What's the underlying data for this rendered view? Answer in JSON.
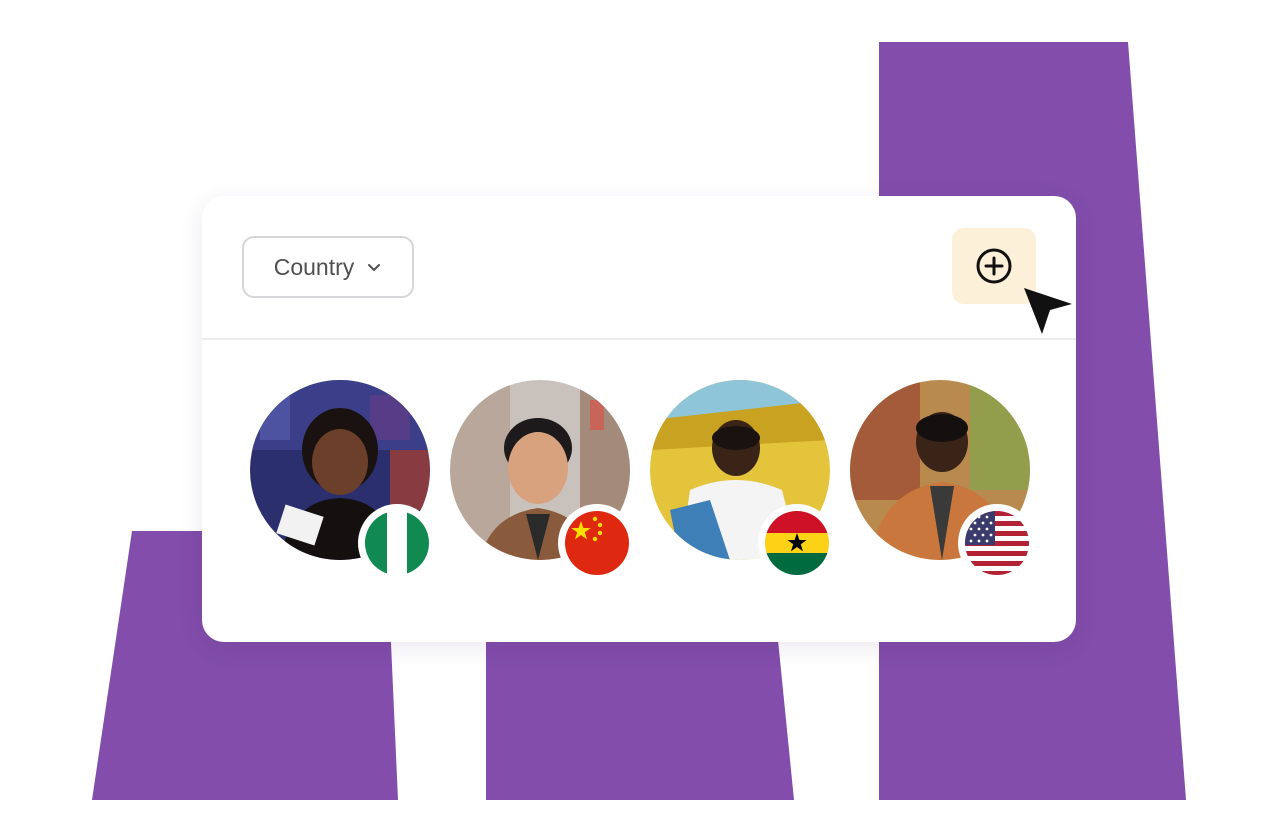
{
  "filter": {
    "country_label": "Country",
    "icon": "chevron-down-icon"
  },
  "add_button": {
    "icon": "plus-circle-icon",
    "background": "#fdf0d8"
  },
  "people": [
    {
      "flag": "nigeria-flag-icon"
    },
    {
      "flag": "china-flag-icon"
    },
    {
      "flag": "ghana-flag-icon"
    },
    {
      "flag": "usa-flag-icon"
    }
  ],
  "colors": {
    "accent_purple": "#824dab",
    "card_background": "#ffffff",
    "divider": "#ececec",
    "dropdown_border": "#d6d6da"
  }
}
